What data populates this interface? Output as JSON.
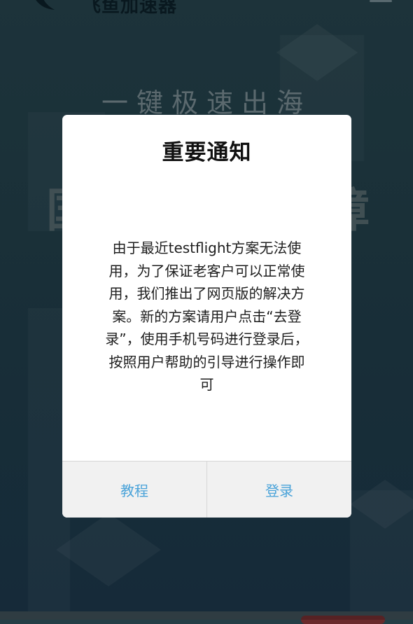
{
  "header": {
    "app_name": "飞鱼加速器",
    "logo_icon": "fish-logo-icon",
    "menu_icon": "hamburger-menu-icon"
  },
  "hero": {
    "slogan": "一键极速出海",
    "big_text_left": "国",
    "big_text_right": "障"
  },
  "dialog": {
    "title": "重要通知",
    "message": "由于最近testflight方案无法使\n用，为了保证老客户可以正常使\n用，我们推出了网页版的解决方\n案。新的方案请用户点击“去登\n录”，使用手机号码进行登录后，\n按照用户帮助的引导进行操作即\n可",
    "buttons": {
      "tutorial_label": "教程",
      "login_label": "登录"
    }
  },
  "colors": {
    "background": "#1f3a45",
    "button_text": "#4aa3d9",
    "dialog_bg": "#ffffff"
  }
}
